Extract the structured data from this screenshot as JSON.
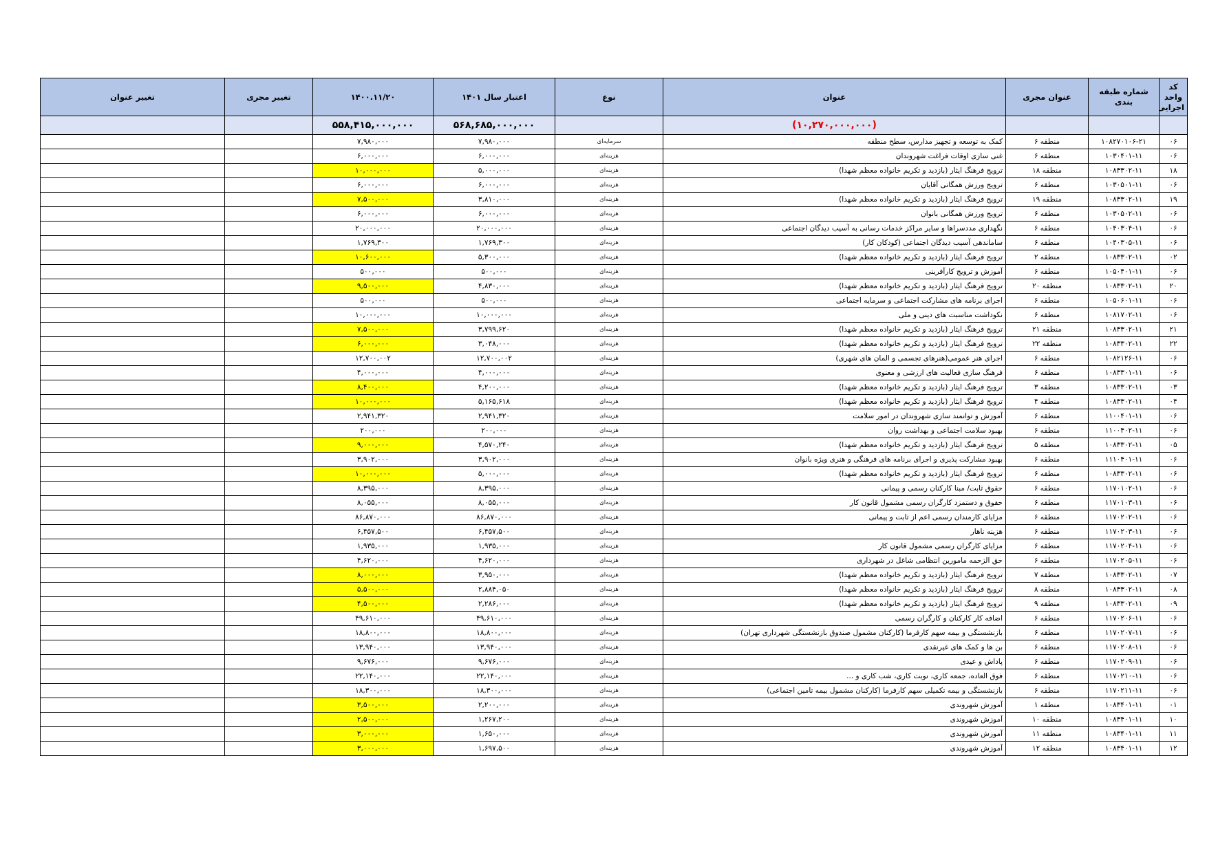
{
  "headers": {
    "code": "کد واحد اجرایی",
    "class_no": "شماره طبقه بندی",
    "executor": "عنوان مجری",
    "title": "عنوان",
    "type": "نوع",
    "budget": "اعتبار سال ۱۴۰۱",
    "date": "۱۴۰۰.۱۱/۲۰",
    "exec_change": "تغییر مجری",
    "title_change": "تغییر عنوان"
  },
  "totals": {
    "title": "(۱۰,۲۷۰,۰۰۰,۰۰۰)",
    "budget": "۵۶۸,۶۸۵,۰۰۰,۰۰۰",
    "date": "۵۵۸,۴۱۵,۰۰۰,۰۰۰"
  },
  "rows": [
    {
      "code": "۰۶",
      "class_no": "۱۰۸۲۷۰۱۰۶-۲۱",
      "executor": "منطقه ۶",
      "title": "کمک به توسعه و تجهیز مدارس، سطح منطقه",
      "type": "سرمایه‌ای",
      "budget": "۷,۹۸۰,۰۰۰",
      "date": "۷,۹۸۰,۰۰۰",
      "hl": false
    },
    {
      "code": "۰۶",
      "class_no": "۱۰۳۰۴۰۱-۱۱",
      "executor": "منطقه ۶",
      "title": "غنی سازی اوقات فراغت شهروندان",
      "type": "هزینه‌ای",
      "budget": "۶,۰۰۰,۰۰۰",
      "date": "۶,۰۰۰,۰۰۰",
      "hl": false
    },
    {
      "code": "۱۸",
      "class_no": "۱۰۸۳۳۰۲-۱۱",
      "executor": "منطقه ۱۸",
      "title": "ترویج فرهنگ ایثار (بازدید و تکریم خانواده معظم شهدا)",
      "type": "هزینه‌ای",
      "budget": "۵,۰۰۰,۰۰۰",
      "date": "۱۰,۰۰۰,۰۰۰",
      "hl": true
    },
    {
      "code": "۰۶",
      "class_no": "۱۰۳۰۵۰۱-۱۱",
      "executor": "منطقه ۶",
      "title": "ترویج ورزش همگانی آقایان",
      "type": "هزینه‌ای",
      "budget": "۶,۰۰۰,۰۰۰",
      "date": "۶,۰۰۰,۰۰۰",
      "hl": false
    },
    {
      "code": "۱۹",
      "class_no": "۱۰۸۳۳۰۲-۱۱",
      "executor": "منطقه ۱۹",
      "title": "ترویج فرهنگ ایثار (بازدید و تکریم خانواده معظم شهدا)",
      "type": "هزینه‌ای",
      "budget": "۳,۸۱۰,۰۰۰",
      "date": "۷,۵۰۰,۰۰۰",
      "hl": true
    },
    {
      "code": "۰۶",
      "class_no": "۱۰۳۰۵۰۲-۱۱",
      "executor": "منطقه ۶",
      "title": "ترویج ورزش همگانی بانوان",
      "type": "هزینه‌ای",
      "budget": "۶,۰۰۰,۰۰۰",
      "date": "۶,۰۰۰,۰۰۰",
      "hl": false
    },
    {
      "code": "۰۶",
      "class_no": "۱۰۴۰۳۰۴-۱۱",
      "executor": "منطقه ۶",
      "title": "نگهداری مددسراها و سایر مراکز خدمات رسانی به آسیب دیدگان اجتماعی",
      "type": "هزینه‌ای",
      "budget": "۲۰,۰۰۰,۰۰۰",
      "date": "۲۰,۰۰۰,۰۰۰",
      "hl": false
    },
    {
      "code": "۰۶",
      "class_no": "۱۰۴۰۳۰۵-۱۱",
      "executor": "منطقه ۶",
      "title": "ساماندهی آسیب دیدگان اجتماعی (کودکان کار)",
      "type": "هزینه‌ای",
      "budget": "۱,۷۶۹,۳۰۰",
      "date": "۱,۷۶۹,۳۰۰",
      "hl": false
    },
    {
      "code": "۰۲",
      "class_no": "۱۰۸۳۳۰۲-۱۱",
      "executor": "منطقه ۲",
      "title": "ترویج فرهنگ ایثار (بازدید و تکریم خانواده معظم شهدا)",
      "type": "هزینه‌ای",
      "budget": "۵,۳۰۰,۰۰۰",
      "date": "۱۰,۶۰۰,۰۰۰",
      "hl": true
    },
    {
      "code": "۰۶",
      "class_no": "۱۰۵۰۴۰۱-۱۱",
      "executor": "منطقه ۶",
      "title": "آموزش و ترویج کارآفرینی",
      "type": "هزینه‌ای",
      "budget": "۵۰۰,۰۰۰",
      "date": "۵۰۰,۰۰۰",
      "hl": false
    },
    {
      "code": "۲۰",
      "class_no": "۱۰۸۳۳۰۲-۱۱",
      "executor": "منطقه ۲۰",
      "title": "ترویج فرهنگ ایثار (بازدید و تکریم خانواده معظم شهدا)",
      "type": "هزینه‌ای",
      "budget": "۴,۸۳۰,۰۰۰",
      "date": "۹,۵۰۰,۰۰۰",
      "hl": true
    },
    {
      "code": "۰۶",
      "class_no": "۱۰۵۰۶۰۱-۱۱",
      "executor": "منطقه ۶",
      "title": "اجرای برنامه های مشارکت اجتماعی و سرمایه اجتماعی",
      "type": "هزینه‌ای",
      "budget": "۵۰۰,۰۰۰",
      "date": "۵۰۰,۰۰۰",
      "hl": false
    },
    {
      "code": "۰۶",
      "class_no": "۱۰۸۱۷۰۲-۱۱",
      "executor": "منطقه ۶",
      "title": "نکوداشت مناسبت های دینی و ملی",
      "type": "هزینه‌ای",
      "budget": "۱۰,۰۰۰,۰۰۰",
      "date": "۱۰,۰۰۰,۰۰۰",
      "hl": false
    },
    {
      "code": "۲۱",
      "class_no": "۱۰۸۳۳۰۲-۱۱",
      "executor": "منطقه ۲۱",
      "title": "ترویج فرهنگ ایثار (بازدید و تکریم خانواده معظم شهدا)",
      "type": "هزینه‌ای",
      "budget": "۳,۷۹۹,۶۲۰",
      "date": "۷,۵۰۰,۰۰۰",
      "hl": true
    },
    {
      "code": "۲۲",
      "class_no": "۱۰۸۳۳۰۲-۱۱",
      "executor": "منطقه ۲۲",
      "title": "ترویج فرهنگ ایثار (بازدید و تکریم خانواده معظم شهدا)",
      "type": "هزینه‌ای",
      "budget": "۳,۰۴۸,۰۰۰",
      "date": "۶,۰۰۰,۰۰۰",
      "hl": true
    },
    {
      "code": "۰۶",
      "class_no": "۱۰۸۲۱۲۶-۱۱",
      "executor": "منطقه ۶",
      "title": "اجرای هنر عمومی(هنرهای تجسمی و المان های شهری)",
      "type": "هزینه‌ای",
      "budget": "۱۲,۷۰۰,۰۰۲",
      "date": "۱۲,۷۰۰,۰۰۲",
      "hl": false
    },
    {
      "code": "۰۶",
      "class_no": "۱۰۸۳۳۰۱-۱۱",
      "executor": "منطقه ۶",
      "title": "فرهنگ سازی فعالیت های ارزشی و معنوی",
      "type": "هزینه‌ای",
      "budget": "۴,۰۰۰,۰۰۰",
      "date": "۴,۰۰۰,۰۰۰",
      "hl": false
    },
    {
      "code": "۰۳",
      "class_no": "۱۰۸۳۳۰۲-۱۱",
      "executor": "منطقه ۳",
      "title": "ترویج فرهنگ ایثار (بازدید و تکریم خانواده معظم شهدا)",
      "type": "هزینه‌ای",
      "budget": "۴,۲۰۰,۰۰۰",
      "date": "۸,۴۰۰,۰۰۰",
      "hl": true
    },
    {
      "code": "۰۴",
      "class_no": "۱۰۸۳۳۰۲-۱۱",
      "executor": "منطقه ۴",
      "title": "ترویج فرهنگ ایثار (بازدید و تکریم خانواده معظم شهدا)",
      "type": "هزینه‌ای",
      "budget": "۵,۱۶۵,۶۱۸",
      "date": "۱۰,۰۰۰,۰۰۰",
      "hl": true
    },
    {
      "code": "۰۶",
      "class_no": "۱۱۰۰۴۰۱-۱۱",
      "executor": "منطقه ۶",
      "title": "آموزش و توانمند سازی شهروندان در امور سلامت",
      "type": "هزینه‌ای",
      "budget": "۲,۹۴۱,۳۲۰",
      "date": "۲,۹۴۱,۳۲۰",
      "hl": false
    },
    {
      "code": "۰۶",
      "class_no": "۱۱۰۰۴۰۲-۱۱",
      "executor": "منطقه ۶",
      "title": "بهبود سلامت اجتماعی و بهداشت روان",
      "type": "هزینه‌ای",
      "budget": "۲۰۰,۰۰۰",
      "date": "۲۰۰,۰۰۰",
      "hl": false
    },
    {
      "code": "۰۵",
      "class_no": "۱۰۸۳۳۰۲-۱۱",
      "executor": "منطقه ۵",
      "title": "ترویج فرهنگ ایثار (بازدید و تکریم خانواده معظم شهدا)",
      "type": "هزینه‌ای",
      "budget": "۴,۵۷۰,۲۴۰",
      "date": "۹,۰۰۰,۰۰۰",
      "hl": true
    },
    {
      "code": "۰۶",
      "class_no": "۱۱۱۰۴۰۱-۱۱",
      "executor": "منطقه ۶",
      "title": "بهبود مشارکت پذیری و اجرای برنامه های فرهنگی و هنری ویژه بانوان",
      "type": "هزینه‌ای",
      "budget": "۳,۹۰۲,۰۰۰",
      "date": "۳,۹۰۲,۰۰۰",
      "hl": false
    },
    {
      "code": "۰۶",
      "class_no": "۱۰۸۳۳۰۲-۱۱",
      "executor": "منطقه ۶",
      "title": "ترویج فرهنگ ایثار (بازدید و تکریم خانواده معظم شهدا)",
      "type": "هزینه‌ای",
      "budget": "۵,۰۰۰,۰۰۰",
      "date": "۱۰,۰۰۰,۰۰۰",
      "hl": true
    },
    {
      "code": "۰۶",
      "class_no": "۱۱۷۰۱۰۲-۱۱",
      "executor": "منطقه ۶",
      "title": "حقوق ثابت/ مبنا کارکنان رسمی و پیمانی",
      "type": "هزینه‌ای",
      "budget": "۸,۳۹۵,۰۰۰",
      "date": "۸,۳۹۵,۰۰۰",
      "hl": false
    },
    {
      "code": "۰۶",
      "class_no": "۱۱۷۰۱۰۳-۱۱",
      "executor": "منطقه ۶",
      "title": "حقوق و دستمزد کارگران رسمی مشمول قانون کار",
      "type": "هزینه‌ای",
      "budget": "۸,۰۵۵,۰۰۰",
      "date": "۸,۰۵۵,۰۰۰",
      "hl": false
    },
    {
      "code": "۰۶",
      "class_no": "۱۱۷۰۲۰۲-۱۱",
      "executor": "منطقه ۶",
      "title": "مزایای کارمندان رسمی اعم از ثابت و پیمانی",
      "type": "هزینه‌ای",
      "budget": "۸۶,۸۷۰,۰۰۰",
      "date": "۸۶,۸۷۰,۰۰۰",
      "hl": false
    },
    {
      "code": "۰۶",
      "class_no": "۱۱۷۰۲۰۳-۱۱",
      "executor": "منطقه ۶",
      "title": "هزینه ناهار",
      "type": "هزینه‌ای",
      "budget": "۶,۴۵۷,۵۰۰",
      "date": "۶,۴۵۷,۵۰۰",
      "hl": false
    },
    {
      "code": "۰۶",
      "class_no": "۱۱۷۰۲۰۴-۱۱",
      "executor": "منطقه ۶",
      "title": "مزایای کارگران رسمی مشمول قانون کار",
      "type": "هزینه‌ای",
      "budget": "۱,۹۳۵,۰۰۰",
      "date": "۱,۹۳۵,۰۰۰",
      "hl": false
    },
    {
      "code": "۰۶",
      "class_no": "۱۱۷۰۲۰۵-۱۱",
      "executor": "منطقه ۶",
      "title": "حق الزحمه مامورین انتظامی شاغل در شهرداری",
      "type": "هزینه‌ای",
      "budget": "۴,۶۲۰,۰۰۰",
      "date": "۴,۶۲۰,۰۰۰",
      "hl": false
    },
    {
      "code": "۰۷",
      "class_no": "۱۰۸۳۳۰۲-۱۱",
      "executor": "منطقه ۷",
      "title": "ترویج فرهنگ ایثار (بازدید و تکریم خانواده معظم شهدا)",
      "type": "هزینه‌ای",
      "budget": "۳,۹۵۰,۰۰۰",
      "date": "۸,۰۰۰,۰۰۰",
      "hl": true
    },
    {
      "code": "۰۸",
      "class_no": "۱۰۸۳۳۰۲-۱۱",
      "executor": "منطقه ۸",
      "title": "ترویج فرهنگ ایثار (بازدید و تکریم خانواده معظم شهدا)",
      "type": "هزینه‌ای",
      "budget": "۲,۸۸۴,۰۵۰",
      "date": "۵,۵۰۰,۰۰۰",
      "hl": true
    },
    {
      "code": "۰۹",
      "class_no": "۱۰۸۳۳۰۲-۱۱",
      "executor": "منطقه ۹",
      "title": "ترویج فرهنگ ایثار (بازدید و تکریم خانواده معظم شهدا)",
      "type": "هزینه‌ای",
      "budget": "۲,۲۸۶,۰۰۰",
      "date": "۴,۵۰۰,۰۰۰",
      "hl": true
    },
    {
      "code": "۰۶",
      "class_no": "۱۱۷۰۲۰۶-۱۱",
      "executor": "منطقه ۶",
      "title": "اضافه کار کارکنان و کارگران رسمی",
      "type": "هزینه‌ای",
      "budget": "۴۹,۶۱۰,۰۰۰",
      "date": "۴۹,۶۱۰,۰۰۰",
      "hl": false
    },
    {
      "code": "۰۶",
      "class_no": "۱۱۷۰۲۰۷-۱۱",
      "executor": "منطقه ۶",
      "title": "بازنشستگی و بیمه سهم کارفرما (کارکنان مشمول صندوق بازنشستگی شهرداری تهران)",
      "type": "هزینه‌ای",
      "budget": "۱۸,۸۰۰,۰۰۰",
      "date": "۱۸,۸۰۰,۰۰۰",
      "hl": false
    },
    {
      "code": "۰۶",
      "class_no": "۱۱۷۰۲۰۸-۱۱",
      "executor": "منطقه ۶",
      "title": "بن ها و کمک های غیرنقدی",
      "type": "هزینه‌ای",
      "budget": "۱۳,۹۴۰,۰۰۰",
      "date": "۱۳,۹۴۰,۰۰۰",
      "hl": false
    },
    {
      "code": "۰۶",
      "class_no": "۱۱۷۰۲۰۹-۱۱",
      "executor": "منطقه ۶",
      "title": "پاداش و عیدی",
      "type": "هزینه‌ای",
      "budget": "۹,۶۷۶,۰۰۰",
      "date": "۹,۶۷۶,۰۰۰",
      "hl": false
    },
    {
      "code": "۰۶",
      "class_no": "۱۱۷۰۲۱۰-۱۱",
      "executor": "منطقه ۶",
      "title": "فوق العاده، جمعه کاری، نوبت کاری، شب کاری و ...",
      "type": "هزینه‌ای",
      "budget": "۲۲,۱۴۰,۰۰۰",
      "date": "۲۲,۱۴۰,۰۰۰",
      "hl": false
    },
    {
      "code": "۰۶",
      "class_no": "۱۱۷۰۲۱۱-۱۱",
      "executor": "منطقه ۶",
      "title": "بازنشستگی و بیمه تکمیلی سهم کارفرما (کارکنان مشمول بیمه تامین اجتماعی)",
      "type": "هزینه‌ای",
      "budget": "۱۸,۳۰۰,۰۰۰",
      "date": "۱۸,۳۰۰,۰۰۰",
      "hl": false
    },
    {
      "code": "۰۱",
      "class_no": "۱۰۸۳۴۰۱-۱۱",
      "executor": "منطقه ۱",
      "title": "آموزش شهروندی",
      "type": "هزینه‌ای",
      "budget": "۲,۲۰۰,۰۰۰",
      "date": "۳,۵۰۰,۰۰۰",
      "hl": true
    },
    {
      "code": "۱۰",
      "class_no": "۱۰۸۳۴۰۱-۱۱",
      "executor": "منطقه ۱۰",
      "title": "آموزش شهروندی",
      "type": "هزینه‌ای",
      "budget": "۱,۲۶۷,۲۰۰",
      "date": "۲,۵۰۰,۰۰۰",
      "hl": true
    },
    {
      "code": "۱۱",
      "class_no": "۱۰۸۳۴۰۱-۱۱",
      "executor": "منطقه ۱۱",
      "title": "آموزش شهروندی",
      "type": "هزینه‌ای",
      "budget": "۱,۶۵۰,۰۰۰",
      "date": "۳,۰۰۰,۰۰۰",
      "hl": true
    },
    {
      "code": "۱۲",
      "class_no": "۱۰۸۳۴۰۱-۱۱",
      "executor": "منطقه ۱۲",
      "title": "آموزش شهروندی",
      "type": "هزینه‌ای",
      "budget": "۱,۶۹۷,۵۰۰",
      "date": "۳,۰۰۰,۰۰۰",
      "hl": true
    }
  ]
}
